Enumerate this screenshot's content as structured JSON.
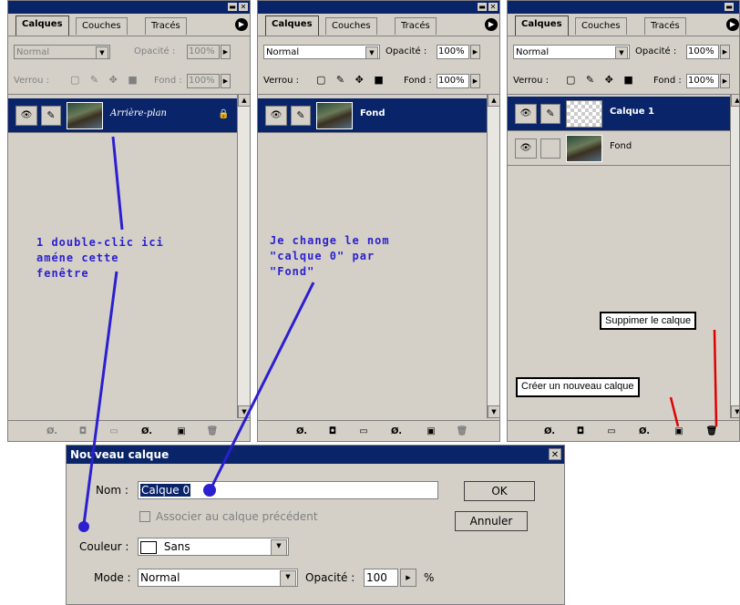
{
  "colors": {
    "annotation": "#2b1fd0",
    "highlight": "#0a246a",
    "pointer_red": "#e00000"
  },
  "panels": [
    {
      "tabs": [
        "Calques",
        "Couches",
        "Tracés"
      ],
      "blend_mode": "Normal",
      "opacity_label": "Opacité :",
      "opacity_value": "100%",
      "lock_label": "Verrou :",
      "fill_label": "Fond :",
      "fill_value": "100%",
      "layers": [
        {
          "name": "Arrière-plan",
          "selected": true,
          "locked": true
        }
      ]
    },
    {
      "tabs": [
        "Calques",
        "Couches",
        "Tracés"
      ],
      "blend_mode": "Normal",
      "opacity_label": "Opacité :",
      "opacity_value": "100%",
      "lock_label": "Verrou :",
      "fill_label": "Fond :",
      "fill_value": "100%",
      "layers": [
        {
          "name": "Fond",
          "selected": true
        }
      ]
    },
    {
      "tabs": [
        "Calques",
        "Couches",
        "Tracés"
      ],
      "blend_mode": "Normal",
      "opacity_label": "Opacité :",
      "opacity_value": "100%",
      "lock_label": "Verrou :",
      "fill_label": "Fond :",
      "fill_value": "100%",
      "layers": [
        {
          "name": "Calque 1",
          "selected": true
        },
        {
          "name": "Fond",
          "selected": false
        }
      ],
      "callouts": {
        "delete": "Suppimer le calque",
        "new": "Créer un nouveau calque"
      }
    }
  ],
  "annotations": {
    "left": "1 double-clic ici\naméne cette\nfenêtre",
    "middle": "Je change le nom\n\"calque 0\" par\n\"Fond\""
  },
  "dialog": {
    "title": "Nouveau calque",
    "name_label": "Nom :",
    "name_value": "Calque 0",
    "associate_label": "Associer au calque précédent",
    "color_label": "Couleur :",
    "color_value": "Sans",
    "mode_label": "Mode :",
    "mode_value": "Normal",
    "opacity_label": "Opacité :",
    "opacity_value": "100",
    "percent": "%",
    "ok_label": "OK",
    "cancel_label": "Annuler"
  }
}
